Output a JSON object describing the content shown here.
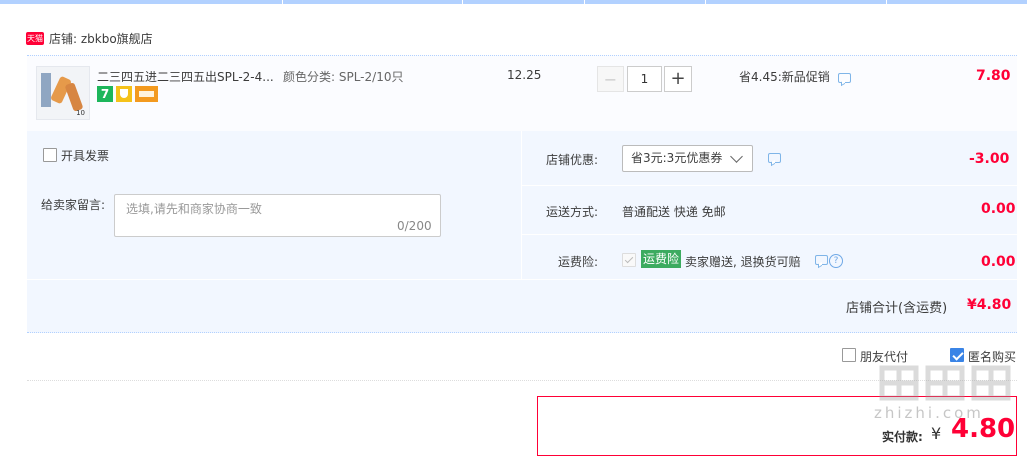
{
  "shop": {
    "tag": "天猫",
    "label": "店铺: zbkbo旗舰店"
  },
  "item": {
    "title": "二三四五进二三四五出SPL-2-4...",
    "spec": "颜色分类: SPL-2/10只",
    "thumb_text": "10",
    "badge_seven": "7",
    "unit_price": "12.25",
    "quantity": "1",
    "minus": "−",
    "plus": "+",
    "promo": "省4.45:新品促销",
    "subtotal": "7.80"
  },
  "invoice": {
    "label": "开具发票"
  },
  "message": {
    "label": "给卖家留言:",
    "placeholder": "选填,请先和商家协商一致",
    "count": "0/200"
  },
  "coupon": {
    "label": "店铺优惠:",
    "selected": "省3元:3元优惠券",
    "amount": "-3.00"
  },
  "shipping": {
    "label": "运送方式:",
    "value": "普通配送 快递 免邮",
    "amount": "0.00"
  },
  "insurance": {
    "label": "运费险:",
    "tag": "运费险",
    "text": "卖家赠送, 退换货可赔",
    "help": "?",
    "amount": "0.00"
  },
  "shop_total": {
    "label": "店铺合计(含运费)",
    "amount": "¥4.80"
  },
  "options": {
    "friend_pay": "朋友代付",
    "anonymous": "匿名购买"
  },
  "payment": {
    "label": "实付款:",
    "currency": "¥",
    "amount": "4.80"
  },
  "watermark": {
    "text": "zhizhi.com"
  },
  "colors": {
    "accent": "#ff0036",
    "border": "#b2d1ff",
    "panel": "#f2f7ff"
  }
}
